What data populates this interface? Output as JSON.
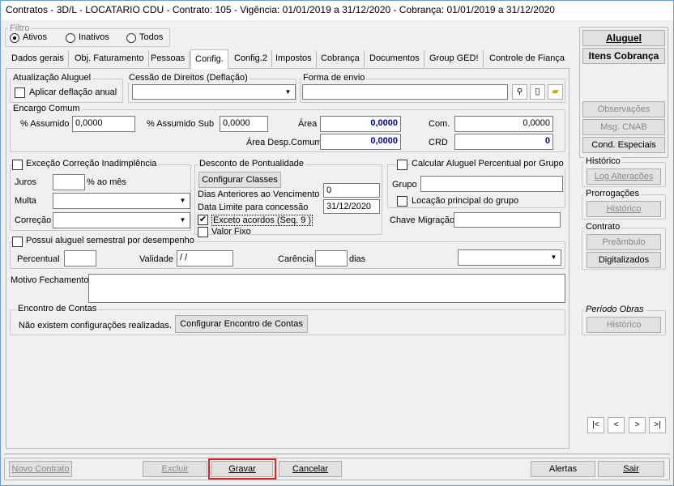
{
  "window": {
    "title": "Contratos - 3D/L - LOCATARIO CDU - Contrato: 105 - Vigência: 01/01/2019 a 31/12/2020 - Cobrança: 01/01/2019 a 31/12/2020"
  },
  "filtro": {
    "label": "Filtro",
    "options": [
      "Ativos",
      "Inativos",
      "Todos"
    ],
    "selected": "Ativos"
  },
  "tabs": [
    "Dados gerais",
    "Obj. Faturamento",
    "Pessoas",
    "Config.",
    "Config.2",
    "Impostos",
    "Cobrança",
    "Documentos",
    "Group GED!",
    "Controle de Fiança"
  ],
  "active_tab": "Config.",
  "atualizacao": {
    "label": "Atualização Aluguel",
    "aplicar": "Aplicar deflação anual"
  },
  "cessao": {
    "label": "Cessão de Direitos (Deflação)",
    "value": ""
  },
  "forma_envio": {
    "label": "Forma de envio",
    "value": ""
  },
  "encargo": {
    "label": "Encargo Comum",
    "assumido_label": "% Assumido",
    "assumido": "0,0000",
    "assumido_sub_label": "% Assumido Sub",
    "assumido_sub": "0,0000",
    "area_label": "Área",
    "area": "0,0000",
    "com_label": "Com.",
    "com": "0,0000",
    "area_desp_label": "Área Desp.Comum",
    "area_desp": "0,0000",
    "crd_label": "CRD",
    "crd": "0"
  },
  "excecao": {
    "label": "Exceção Correção Inadimplência",
    "juros_label": "Juros",
    "juros": "",
    "juros_suffix": "% ao mês",
    "multa_label": "Multa",
    "multa": "",
    "correcao_label": "Correção",
    "correcao": ""
  },
  "desconto": {
    "label": "Desconto de Pontualidade",
    "config_btn": "Configurar Classes",
    "dias_label": "Dias Anteriores ao Vencimento",
    "dias": "0",
    "data_label": "Data Limite para concessão",
    "data": "31/12/2020",
    "exceto": "Exceto acordos (Seq. 9 )",
    "valor_fixo": "Valor Fixo"
  },
  "calc_grupo": {
    "label": "Calcular Aluguel Percentual por Grupo",
    "grupo_label": "Grupo",
    "grupo": "",
    "locacao": "Locação principal do grupo"
  },
  "chave": {
    "label": "Chave Migração",
    "value": ""
  },
  "semestral": {
    "label": "Possui aluguel semestral por desempenho",
    "percentual_label": "Percentual",
    "percentual": "",
    "validade_label": "Validade",
    "validade": " / /",
    "carencia_label": "Carência",
    "carencia": "",
    "dias_label": "dias",
    "select": ""
  },
  "motivo": {
    "label": "Motivo Fechamento",
    "value": ""
  },
  "encontro": {
    "label": "Encontro de Contas",
    "text": "Não existem configurações realizadas.",
    "button": "Configurar Encontro de Contas"
  },
  "side": {
    "aluguel": "Aluguel",
    "itens": "Itens Cobrança",
    "observacoes": "Observações",
    "msg_cnab": "Msg. CNAB",
    "cond": "Cond. Especiais",
    "historico_label": "Histórico",
    "log": "Log Alterações",
    "prorrog_label": "Prorrogações",
    "prorrog_hist": "Histórico",
    "contrato_label": "Contrato",
    "preambulo": "Preâmbulo",
    "digitalizados": "Digitalizados",
    "periodo_label": "Período Obras",
    "periodo_hist": "Histórico"
  },
  "nav": [
    "|<",
    "<",
    ">",
    ">|"
  ],
  "footer": {
    "novo": "Novo Contrato",
    "excluir": "Excluir",
    "gravar": "Gravar",
    "cancelar": "Cancelar",
    "alertas": "Alertas",
    "sair": "Sair"
  },
  "colors": {
    "highlight": "#e02020",
    "value_blue": "#0000a0"
  }
}
